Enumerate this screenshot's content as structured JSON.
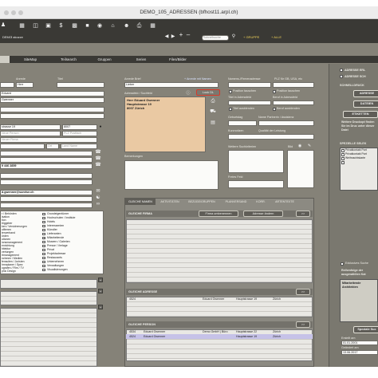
{
  "window": {
    "title": "DEMO_105_ADRESSEN (bfhost11.arpl.ch)"
  },
  "toolbar": {
    "db_label": "DEMO",
    "user": "/ akozze",
    "group_label": "+ GRUPPE",
    "group_label2": "+ ALLE",
    "search_placeholder": "Schnellsuche"
  },
  "tabs": [
    {
      "label": ""
    },
    {
      "label": "SiteMap"
    },
    {
      "label": "Teilsearch"
    },
    {
      "label": "Gruppen"
    },
    {
      "label": "Serien"
    },
    {
      "label": "Files/Bilder"
    }
  ],
  "left": {
    "anrede_label": "Anrede",
    "titel_label": "Titel",
    "anrede_value": "Herr",
    "name_value": "Eduard",
    "vorname_value": "Gwenner",
    "street_value": "strasse 19",
    "plz_value": "8007",
    "person_ph": "Neue Person",
    "firma_ph": "Neuer Firma",
    "postfach_ph": "PLZ Postfach",
    "ort_ph": "Ort",
    "land_ph": "Land Name",
    "phone_value": "9 446 2859",
    "email_value": "d.gwenner@sunrise.ch",
    "categories_left": [
      "r / Behörden",
      "isation",
      "tion",
      "triggeber",
      "ken / Versicherungen",
      "ulfirmen",
      "tenverband",
      "ürden",
      "utionen",
      "ionsmanagement",
      "enrichtung",
      "hitektur",
      "vertungen",
      "rtmanagement",
      "nchmen / Medien",
      "fensuiten / Juristen",
      "hmnplaner / Spez",
      "ografen / Film / TV",
      "phic Design"
    ],
    "categories_right": [
      "Grundeigentümer",
      "Hochschulen / Institute",
      "Hotels",
      "Interessenten",
      "Künstler",
      "Lieferanten",
      "Mitarbeitende",
      "Museen / Galerien",
      "Presse / Verlage",
      "Privat",
      "Projektadresse",
      "Restaurants",
      "Unternehmen",
      "Verwaltungen",
      "Visualisierungen"
    ],
    "checked_right": [
      6
    ]
  },
  "mid": {
    "anrede_brief_label": "Anrede Brief",
    "anrede_brief_link": "+ Anrede mit Namen",
    "anrede_brief_value": "Lieber",
    "adressfeld_label": "Adressfeld / Suchfeld",
    "look_btn": "Look DL",
    "address_lines": [
      "Herr Eduard Gwenner",
      "Hauptstrasse 19",
      "8007 Zürich"
    ],
    "bemerkungen_label": "Bemerkungen"
  },
  "right": {
    "namens_label": "Namens-/Firmenadresse",
    "plz_label": "PLZ für GB, USA, etc",
    "pos_tauschen": "Position tauschen",
    "pos_tauschen2": "Position tauschen",
    "titel_adressfeld": "Titel in Adressfeld",
    "beruf_adressfeld": "Beruf in Adressfeld",
    "titel_ausblenden": "Titel ausblenden",
    "beruf_ausblenden": "Beruf ausblenden",
    "geburtstag_label": "Geburtstag",
    "name_partner_label": "Name Partnerin / Assistenz",
    "kurznotizen_label": "Kurznotizen",
    "qualitaet_label": "Qualität der Leistung",
    "suchkriterien_label": "Weitere Suchkriterien",
    "bild_label": "Bild",
    "freies_feld_label": "Freies Feld"
  },
  "sidebar": {
    "adresse_erl": "ADRESSE ERL",
    "adresse_sch": "ADRESSE SCH",
    "schnelldruck": "SCHNELLDRUCK",
    "adresse_btn": "ADRESSE",
    "dateien_btn": "DATEIEN",
    "etiketten_btn": "ETIKETTEN",
    "note": "Weitere Druckopt finden Sie im Druc unter dieser Datei",
    "speziell": "SPEZIELLE SELEK",
    "spez_items": [
      "Privatkontakt Part",
      "Privatkontakt Part",
      "Weihnachtskarte",
      ""
    ],
    "exklusive": "Exklusives Suche",
    "reihenfolge": "Reihenfolge der ausgewählten Kat",
    "mitarbeitende": "Mitarbeitende",
    "architekten": "Architekten",
    "speziale_btn": "Speziale Suc",
    "erstellt_label": "Erstellt am",
    "erstellt_value": "01.01.2001",
    "geaendert_label": "Geändert am",
    "geaendert_value": "13.06.2017"
  },
  "bottom": {
    "tabs": [
      "GLEICHE NAMEN",
      "AKTIVITÄTEN",
      "BEZÜGE/GRUPPEN",
      "PLANVERSAND",
      "KORR.",
      "ARTENTEXTE"
    ],
    "firma_title": "GLEICHE FIRMA",
    "firma_umbenennen": "Firma umbenennen",
    "adresse_aendern": "Adresse ändern",
    "arrow": ">>",
    "adresse_title": "GLEICHE ADRESSE",
    "adresse_rows": [
      {
        "id": "4524",
        "name": "Eduard Gwenner",
        "street": "Hauptstrasse 19",
        "city": "Zürich"
      }
    ],
    "person_title": "GLEICHE PERSON",
    "person_rows": [
      {
        "id": "4534",
        "name": "Eduard Gwenner",
        "firm": "Demo GmbH | Büro",
        "street": "Hauptstrasse 22",
        "city": "Zürich"
      },
      {
        "id": "4524",
        "name": "Eduard Gwenner",
        "firm": "",
        "street": "Hauptstrasse 19",
        "city": "Zürich"
      }
    ]
  },
  "colors": {
    "accent": "#e8c7a0",
    "selected_row": "#c6c2e8",
    "red_frame": "#d63a2a"
  }
}
